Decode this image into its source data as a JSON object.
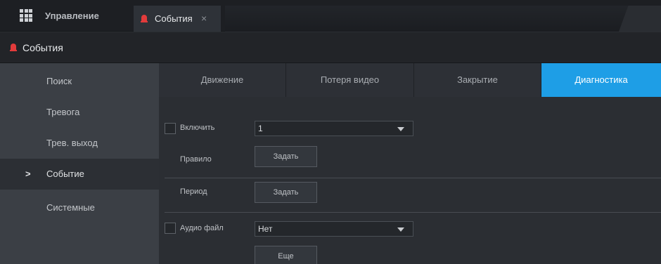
{
  "topbar": {
    "tabs": [
      {
        "label": "Управление"
      },
      {
        "label": "События",
        "close": "×"
      }
    ]
  },
  "section": {
    "title": "События"
  },
  "sidebar": {
    "items": [
      {
        "label": "Поиск"
      },
      {
        "label": "Тревога"
      },
      {
        "label": "Трев. выход"
      },
      {
        "label": "Событие",
        "active": true,
        "marker": ">"
      },
      {
        "label": "Системные"
      }
    ]
  },
  "main": {
    "tabs": [
      {
        "label": "Движение"
      },
      {
        "label": "Потеря видео"
      },
      {
        "label": "Закрытие"
      },
      {
        "label": "Диагностика",
        "active": true
      }
    ],
    "form": {
      "enable_label": "Включить",
      "enable_value": "1",
      "rule_label": "Правило",
      "rule_button": "Задать",
      "period_label": "Период",
      "period_button": "Задать",
      "audio_label": "Аудио файл",
      "audio_value": "Нет",
      "more_button": "Еще"
    }
  },
  "colors": {
    "accent": "#1e9ee6",
    "alarm": "#e23b3b"
  }
}
